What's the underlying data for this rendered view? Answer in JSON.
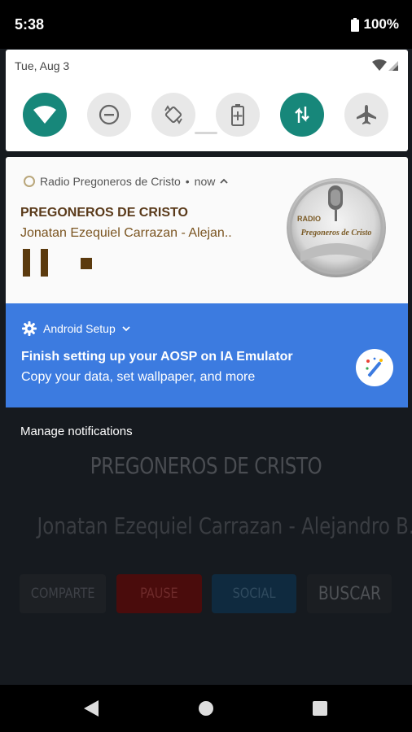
{
  "status_bar": {
    "time": "5:38",
    "battery": "100%",
    "battery_icon": "battery-full-icon"
  },
  "quick_settings": {
    "date": "Tue, Aug 3",
    "tiles": [
      {
        "name": "wifi",
        "icon": "wifi-icon",
        "active": true
      },
      {
        "name": "do-not-disturb",
        "icon": "do-not-disturb-icon",
        "active": false
      },
      {
        "name": "auto-rotate",
        "icon": "auto-rotate-icon",
        "active": false
      },
      {
        "name": "battery-saver",
        "icon": "battery-saver-icon",
        "active": false
      },
      {
        "name": "mobile-data",
        "icon": "data-transfer-icon",
        "active": true
      },
      {
        "name": "airplane-mode",
        "icon": "airplane-icon",
        "active": false
      }
    ]
  },
  "media_notification": {
    "app_name": "Radio Pregoneros de Cristo",
    "separator": "•",
    "time": "now",
    "title": "PREGONEROS DE CRISTO",
    "artist": "Jonatan Ezequiel Carrazan - Alejan..",
    "album_art": {
      "label_top": "RADIO",
      "label_main": "Pregoneros de Cristo"
    }
  },
  "setup_notification": {
    "app_name": "Android Setup",
    "title": "Finish setting up your AOSP on IA Emulator",
    "text": "Copy your data, set wallpaper, and more"
  },
  "manage_notifications": "Manage notifications",
  "app": {
    "title": "PREGONEROS DE CRISTO",
    "artist": "Jonatan Ezequiel Carrazan - Alejandro B..",
    "buttons": {
      "comparte": "COMPARTE",
      "pause": "PAUSE",
      "social": "SOCIAL",
      "buscar": "BUSCAR"
    }
  },
  "colors": {
    "accent_teal": "#17877a",
    "setup_blue": "#3c7be0",
    "media_brown": "#5b3a0e"
  }
}
